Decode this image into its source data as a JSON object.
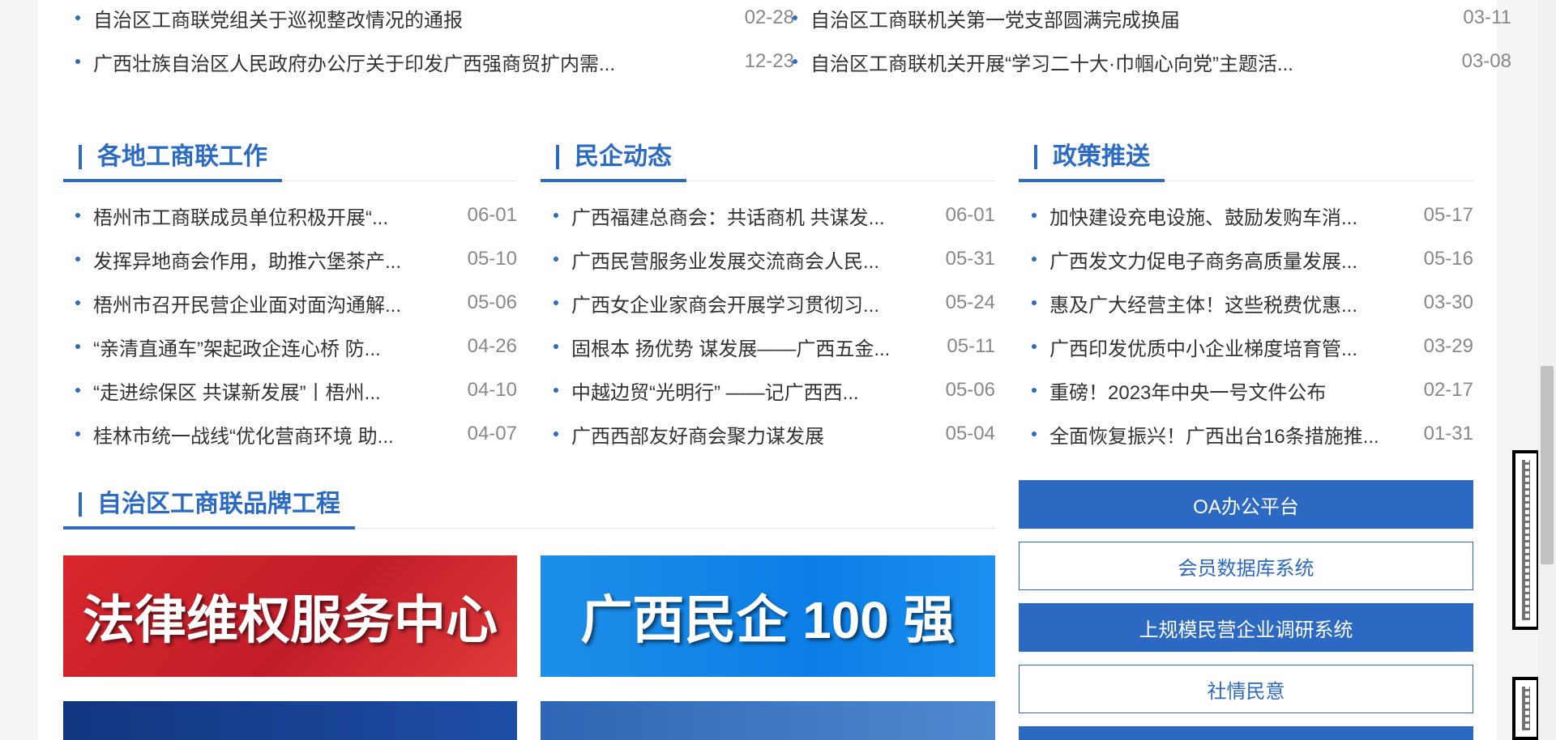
{
  "top_news_left": [
    {
      "title": "自治区工商联党组关于巡视整改情况的通报",
      "date": "02-28"
    },
    {
      "title": "广西壮族自治区人民政府办公厅关于印发广西强商贸扩内需...",
      "date": "12-23"
    }
  ],
  "top_news_right": [
    {
      "title": "自治区工商联机关第一党支部圆满完成换届",
      "date": "03-11"
    },
    {
      "title": "自治区工商联机关开展“学习二十大·巾帼心向党”主题活...",
      "date": "03-08"
    }
  ],
  "sections": {
    "local": {
      "label": "各地工商联工作",
      "items": [
        {
          "title": "梧州市工商联成员单位积极开展“...",
          "date": "06-01"
        },
        {
          "title": "发挥异地商会作用，助推六堡茶产...",
          "date": "05-10"
        },
        {
          "title": "梧州市召开民营企业面对面沟通解...",
          "date": "05-06"
        },
        {
          "title": "“亲清直通车”架起政企连心桥 防...",
          "date": "04-26"
        },
        {
          "title": "“走进综保区 共谋新发展”丨梧州...",
          "date": "04-10"
        },
        {
          "title": "桂林市统一战线“优化营商环境 助...",
          "date": "04-07"
        }
      ]
    },
    "private": {
      "label": "民企动态",
      "items": [
        {
          "title": "广西福建总商会：共话商机 共谋发...",
          "date": "06-01"
        },
        {
          "title": "广西民营服务业发展交流商会人民...",
          "date": "05-31"
        },
        {
          "title": "广西女企业家商会开展学习贯彻习...",
          "date": "05-24"
        },
        {
          "title": "固根本 扬优势 谋发展——广西五金...",
          "date": "05-11"
        },
        {
          "title": "中越边贸“光明行” ——记广西西...",
          "date": "05-06"
        },
        {
          "title": "广西西部友好商会聚力谋发展",
          "date": "05-04"
        }
      ]
    },
    "policy": {
      "label": "政策推送",
      "items": [
        {
          "title": "加快建设充电设施、鼓励发购车消...",
          "date": "05-17"
        },
        {
          "title": "广西发文力促电子商务高质量发展...",
          "date": "05-16"
        },
        {
          "title": "惠及广大经营主体！这些税费优惠...",
          "date": "03-30"
        },
        {
          "title": "广西印发优质中小企业梯度培育管...",
          "date": "03-29"
        },
        {
          "title": "重磅！2023年中央一号文件公布",
          "date": "02-17"
        },
        {
          "title": "全面恢复振兴！广西出台16条措施推...",
          "date": "01-31"
        }
      ]
    },
    "brand": {
      "label": "自治区工商联品牌工程"
    }
  },
  "banners": {
    "legal": "法律维权服务中心",
    "top100": "广西民企 100 强"
  },
  "systems": {
    "oa": "OA办公平台",
    "member_db": "会员数据库系统",
    "survey": "上规模民营企业调研系统",
    "public_opinion": "社情民意"
  },
  "colors": {
    "accent": "#2b6bc4",
    "banner_red": "#d8262c",
    "banner_blue": "#0b7ee6"
  }
}
